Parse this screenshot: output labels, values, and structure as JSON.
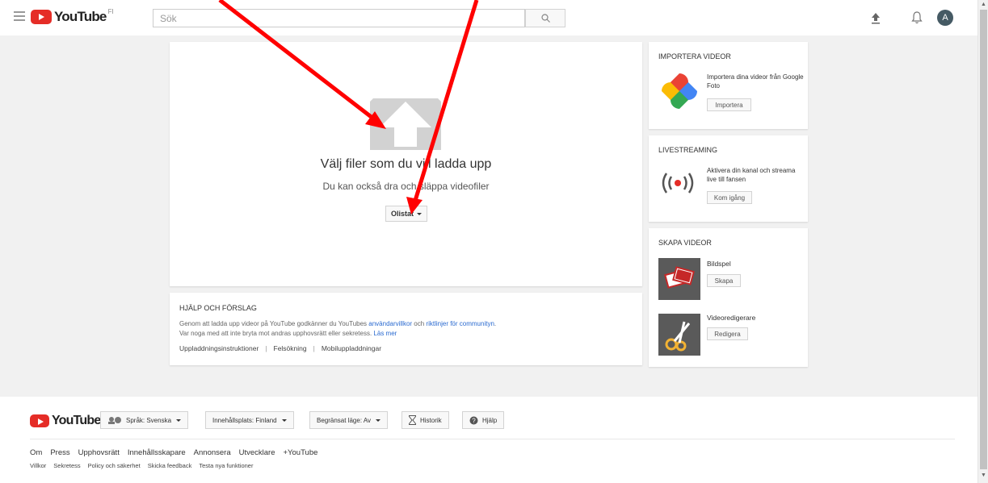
{
  "header": {
    "logo_text": "YouTube",
    "logo_region": "FI",
    "search_placeholder": "Sök",
    "avatar_letter": "A"
  },
  "upload": {
    "title": "Välj filer som du vill ladda upp",
    "subtitle": "Du kan också dra och släppa videofiler",
    "privacy_label": "Olistat"
  },
  "help": {
    "title": "HJÄLP OCH FÖRSLAG",
    "line1_prefix": "Genom att ladda upp videor på YouTube godkänner du YouTubes ",
    "line1_link1": "användarvillkor",
    "line1_mid": " och ",
    "line1_link2": "riktlinjer för communityn",
    "line1_suffix": ".",
    "line2_prefix": "Var noga med att inte bryta mot andras upphovsrätt eller sekretess. ",
    "line2_link": "Läs mer",
    "links": [
      "Uppladdningsinstruktioner",
      "Felsökning",
      "Mobiluppladdningar"
    ]
  },
  "import": {
    "title": "IMPORTERA VIDEOR",
    "text": "Importera dina videor från Google Foto",
    "button": "Importera"
  },
  "live": {
    "title": "LIVESTREAMING",
    "text": "Aktivera din kanal och streama live till fansen",
    "button": "Kom igång"
  },
  "create": {
    "title": "SKAPA VIDEOR",
    "item1_label": "Bildspel",
    "item1_button": "Skapa",
    "item2_label": "Videoredigerare",
    "item2_button": "Redigera"
  },
  "footer": {
    "logo_text": "YouTube",
    "language": "Språk: Svenska",
    "location": "Innehållsplats: Finland",
    "restricted": "Begränsat läge: Av",
    "history": "Historik",
    "help": "Hjälp",
    "links_primary": [
      "Om",
      "Press",
      "Upphovsrätt",
      "Innehållsskapare",
      "Annonsera",
      "Utvecklare",
      "+YouTube"
    ],
    "links_secondary": [
      "Villkor",
      "Sekretess",
      "Policy och säkerhet",
      "Skicka feedback",
      "Testa nya funktioner"
    ]
  },
  "colors": {
    "brand_red": "#e52d27",
    "annotation_red": "#ff0000",
    "link_blue": "#2a6ad0"
  }
}
